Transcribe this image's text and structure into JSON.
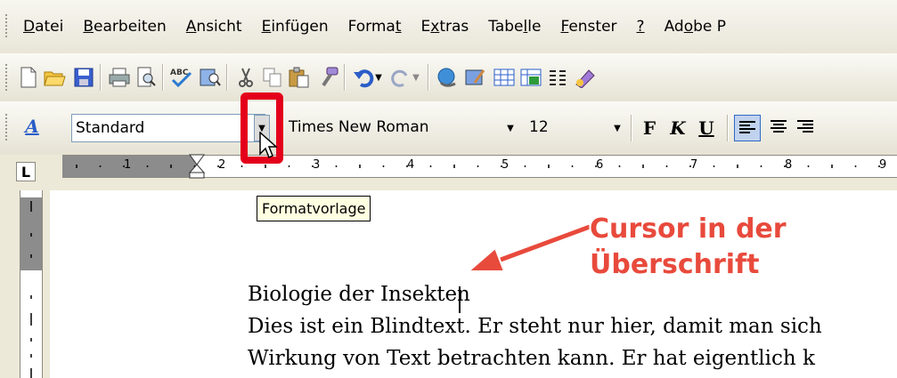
{
  "menu": {
    "items": [
      {
        "pre": "",
        "u": "D",
        "post": "atei"
      },
      {
        "pre": "",
        "u": "B",
        "post": "earbeiten"
      },
      {
        "pre": "",
        "u": "A",
        "post": "nsicht"
      },
      {
        "pre": "",
        "u": "E",
        "post": "infügen"
      },
      {
        "pre": "Forma",
        "u": "t",
        "post": ""
      },
      {
        "pre": "E",
        "u": "x",
        "post": "tras"
      },
      {
        "pre": "Tabe",
        "u": "l",
        "post": "le"
      },
      {
        "pre": "",
        "u": "F",
        "post": "enster"
      },
      {
        "pre": "",
        "u": "?",
        "post": ""
      },
      {
        "pre": "Ad",
        "u": "o",
        "post": "be P"
      }
    ]
  },
  "formatting": {
    "style_value": "Standard",
    "font_value": "Times New Roman",
    "size_value": "12",
    "bold": "F",
    "italic": "K",
    "underline": "U"
  },
  "tooltip": "Formatvorlage",
  "ruler": {
    "numbers": [
      "1",
      "2",
      "3",
      "4",
      "5",
      "6",
      "7",
      "8",
      "9"
    ]
  },
  "document": {
    "heading": "Biologie der Insekten",
    "line1": "Dies ist ein Blindtext. Er steht nur hier, damit man sich",
    "line2": "Wirkung von Text betrachten kann. Er hat eigentlich k"
  },
  "annotation": {
    "line1": "Cursor in der",
    "line2": "Überschrift"
  },
  "colors": {
    "highlight": "#e4001b",
    "annotation": "#e84a3c"
  },
  "icons": {
    "standard": [
      "new-document-icon",
      "open-folder-icon",
      "save-icon",
      "print-icon",
      "print-preview-icon",
      "spell-check-icon",
      "research-icon",
      "cut-icon",
      "copy-icon",
      "paste-icon",
      "format-painter-icon",
      "undo-icon",
      "redo-icon",
      "hyperlink-icon",
      "tables-borders-icon",
      "insert-table-icon",
      "insert-excel-icon",
      "columns-icon",
      "drawing-icon"
    ]
  }
}
